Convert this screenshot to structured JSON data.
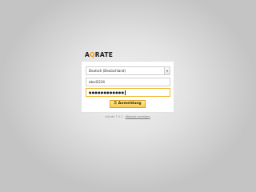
{
  "logo": {
    "part_a": "A",
    "part_q": "Q",
    "part_rest": "RATE"
  },
  "language_select": {
    "selected": "Deutsch (Deutschland)",
    "arrow_icon": "chevron-down-icon"
  },
  "login_form": {
    "username_value": "abcd1234",
    "password_value": "●●●●●●●●●●●●",
    "submit_label": "Anmeldung",
    "submit_icon": "key-icon"
  },
  "footer": {
    "version_text": "aQrate 7.5.1",
    "separator": " · ",
    "link_text": "Website anzeigen"
  },
  "colors": {
    "accent": "#f39c12",
    "button_fill": "#f7c94f",
    "focus_border": "#f0b830"
  }
}
